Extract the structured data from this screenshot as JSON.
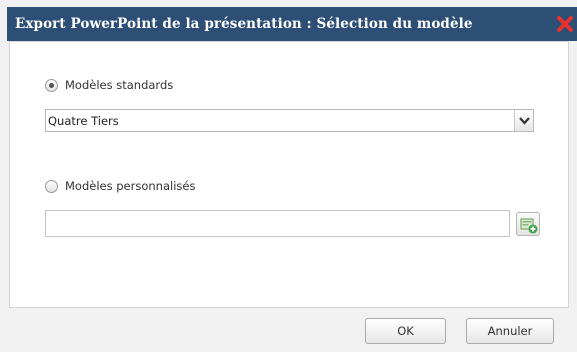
{
  "dialog": {
    "title": "Export PowerPoint de la présentation : Sélection du modèle",
    "close_icon": "close-x-icon",
    "close_color": "#e8312f",
    "title_bg": "#2d4e75"
  },
  "standard": {
    "label": "Modèles standards",
    "checked": true,
    "select_value": "Quatre Tiers",
    "arrow_icon": "chevron-down-icon"
  },
  "custom": {
    "label": "Modèles personnalisés",
    "checked": false,
    "file_value": "",
    "add_icon": "add-template-icon"
  },
  "buttons": {
    "ok": "OK",
    "cancel": "Annuler"
  }
}
